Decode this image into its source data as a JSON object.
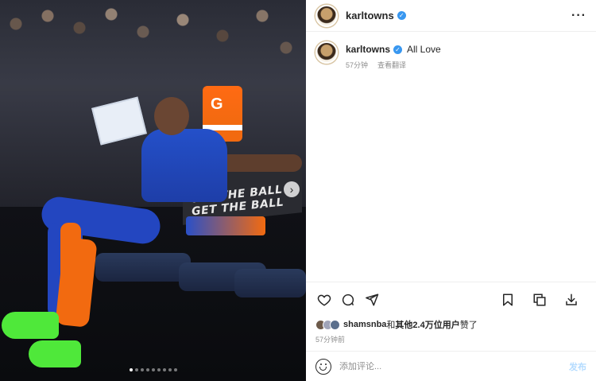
{
  "media": {
    "banner_text": "GET THE BALL GET THE BALL",
    "jug_logo": "G",
    "carousel_next_icon": "chevron-right-icon",
    "carousel": {
      "count": 9,
      "active_index": 0
    }
  },
  "header": {
    "username": "karltowns",
    "verified_icon": "verified-badge-icon",
    "more_icon": "more-horizontal-icon"
  },
  "caption": {
    "username": "karltowns",
    "text": "All Love",
    "time": "57分钟",
    "translate": "查看翻译"
  },
  "actions": {
    "like_icon": "heart-icon",
    "comment_icon": "comment-icon",
    "share_icon": "paper-plane-icon",
    "save_icon": "bookmark-icon",
    "collection_icon": "copy-icon",
    "download_icon": "download-icon"
  },
  "likes": {
    "lead_user": "shamsnba",
    "mid": "和",
    "others": "其他2.4万位用户",
    "suffix": "赞了"
  },
  "post_time": "57分钟前",
  "comment_box": {
    "placeholder": "添加评论...",
    "post_label": "发布"
  },
  "colors": {
    "accent": "#3897f0",
    "post_button_disabled": "#b3dbff",
    "muted_text": "#8e8e8e"
  }
}
